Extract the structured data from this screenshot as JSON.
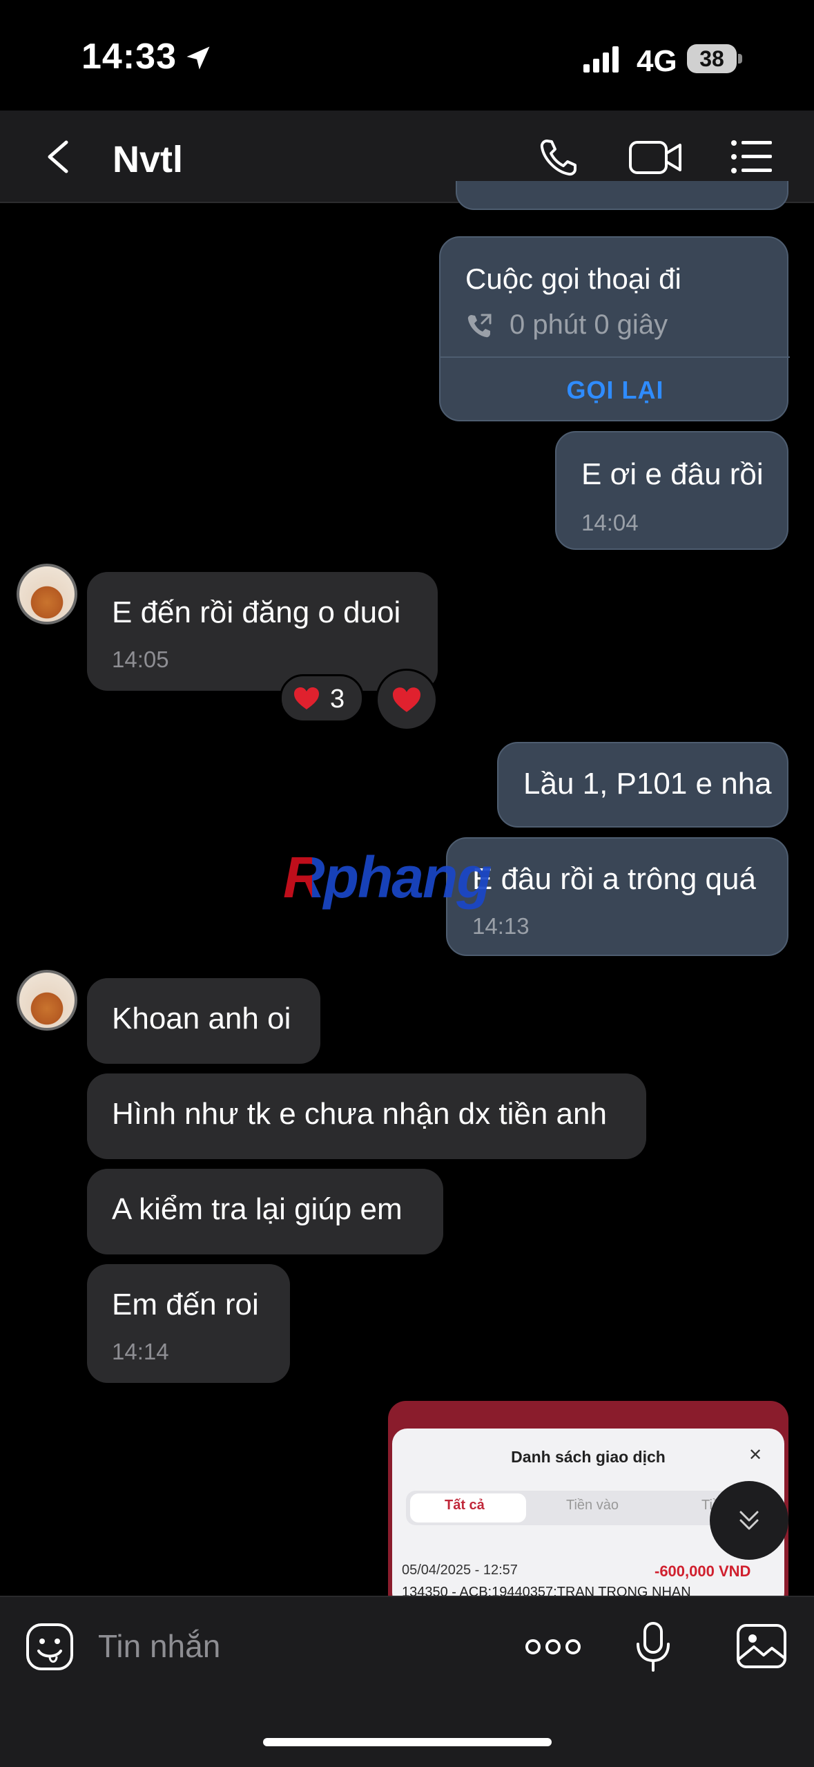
{
  "status_bar": {
    "time": "14:33",
    "network": "4G",
    "battery": "38"
  },
  "header": {
    "title": "Nvtl"
  },
  "call_card": {
    "title": "Cuộc gọi thoại đi",
    "duration": "0 phút 0 giây",
    "action": "GỌI LẠI"
  },
  "messages": [
    {
      "direction": "out",
      "text": "E ơi e đâu rồi",
      "time": "14:04"
    },
    {
      "direction": "in",
      "text": "E đến rồi đăng o duoi",
      "time": "14:05",
      "reaction_count": "3"
    },
    {
      "direction": "out",
      "text": "Lầu 1, P101 e nha"
    },
    {
      "direction": "out",
      "text": "E đâu rồi a trông quá",
      "time": "14:13"
    },
    {
      "direction": "in",
      "text": "Khoan anh oi"
    },
    {
      "direction": "in",
      "text": "Hình như tk e chưa nhận dx tiền anh"
    },
    {
      "direction": "in",
      "text": "A kiểm tra lại giúp em"
    },
    {
      "direction": "in",
      "text": "Em đến roi",
      "time": "14:14"
    }
  ],
  "watermark": "Rphang",
  "screenshot_preview": {
    "title": "Danh sách giao dịch",
    "tabs": [
      "Tất cả",
      "Tiền vào",
      "Tiền"
    ],
    "date": "05/04/2025 - 12:57",
    "amount": "-600,000 VND",
    "reference": "134350 - ACB;19440357;TRAN TRONG NHAN"
  },
  "input": {
    "placeholder": "Tin nhắn"
  },
  "colors": {
    "accent": "#2f8cff",
    "outgoing_bubble": "#3a4656",
    "incoming_bubble": "#2b2b2d",
    "background": "#000000",
    "heart": "#e0212e"
  }
}
